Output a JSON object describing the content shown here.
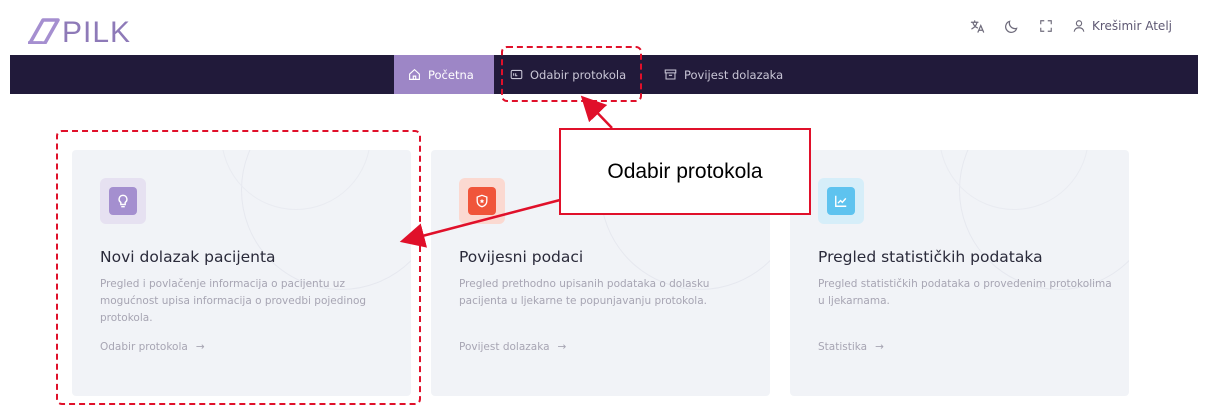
{
  "header": {
    "logo_text": "PILK",
    "icons": [
      "translate-icon",
      "moon-icon",
      "fullscreen-icon",
      "user-icon"
    ],
    "user_name": "Krešimir Atelj"
  },
  "nav": {
    "items": [
      {
        "label": "Početna",
        "icon": "home-icon",
        "active": true
      },
      {
        "label": "Odabir protokola",
        "icon": "protocol-icon",
        "active": false
      },
      {
        "label": "Povijest dolazaka",
        "icon": "archive-icon",
        "active": false
      }
    ]
  },
  "cards": [
    {
      "icon": "lightbulb-icon",
      "icon_color": "#a48fcf",
      "title": "Novi dolazak pacijenta",
      "description": "Pregled i povlačenje informacija o pacijentu uz mogućnost upisa informacija o provedbi pojedinog protokola.",
      "link": "Odabir protokola",
      "arrow": "→"
    },
    {
      "icon": "shield-star-icon",
      "icon_color": "#f0553a",
      "title": "Povijesni podaci",
      "description": "Pregled prethodno upisanih podataka o dolasku pacijenta u ljekarne te popunjavanju protokola.",
      "link": "Povijest dolazaka",
      "arrow": "→"
    },
    {
      "icon": "chart-line-icon",
      "icon_color": "#5ec3ef",
      "title": "Pregled statističkih podataka",
      "description": "Pregled statističkih podataka o provedenim protokolima u ljekarnama.",
      "link": "Statistika",
      "arrow": "→"
    }
  ],
  "annotation": {
    "callout_text": "Odabir protokola",
    "color": "#e0102a"
  }
}
